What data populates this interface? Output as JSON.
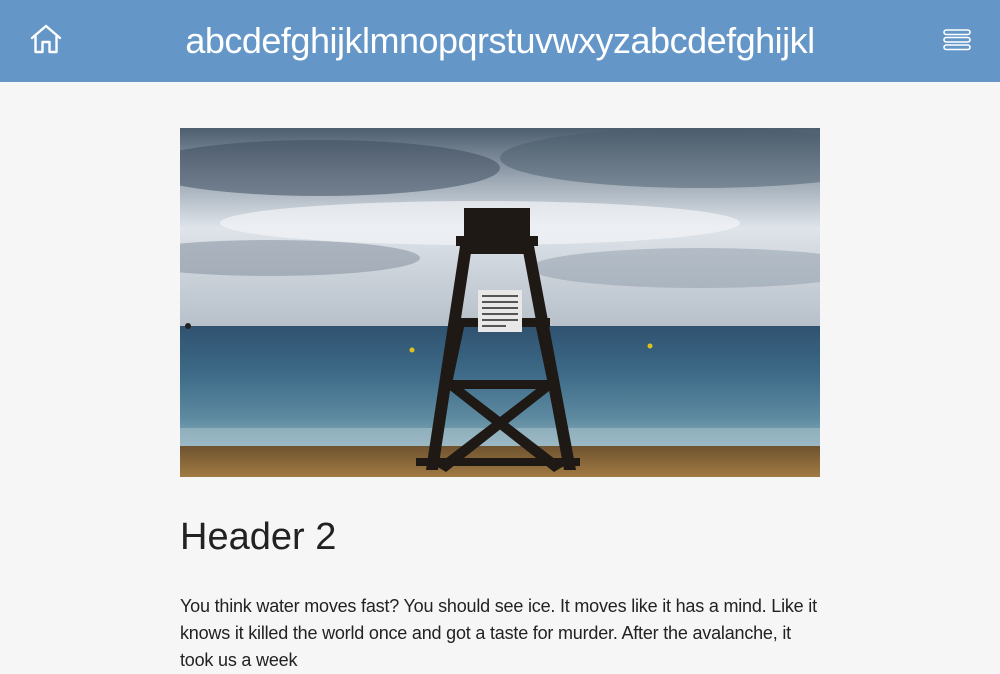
{
  "header": {
    "title": "abcdefghijklmnopqrstuvwxyzabcdefghijkl",
    "home_icon": "home-icon",
    "menu_icon": "menu-icon",
    "background_color": "#6497c8"
  },
  "article": {
    "image_subject": "lifeguard chair on beach at sea",
    "heading": "Header 2",
    "paragraph": "You think water moves fast? You should see ice. It moves like it has a mind. Like it knows it killed the world once and got a taste for murder. After the avalanche, it took us a week"
  }
}
